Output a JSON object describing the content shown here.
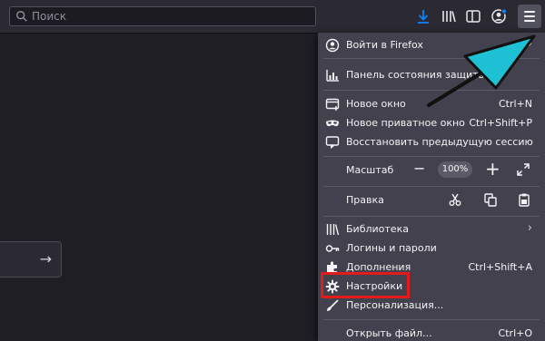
{
  "toolbar": {
    "search_placeholder": "Поиск",
    "icons": [
      "download-icon",
      "library-icon",
      "sidebar-icon",
      "account-icon",
      "hamburger-menu-icon"
    ]
  },
  "content": {
    "go_arrow": "→"
  },
  "menu": {
    "sign_in": "Войти в Firefox",
    "protections": "Панель состояния защиты",
    "new_window": {
      "label": "Новое окно",
      "shortcut": "Ctrl+N"
    },
    "private_window": {
      "label": "Новое приватное окно",
      "shortcut": "Ctrl+Shift+P"
    },
    "restore_session": "Восстановить предыдущую сессию",
    "zoom": {
      "label": "Масштаб",
      "value": "100%",
      "minus": "−",
      "plus": "+"
    },
    "edit": {
      "label": "Правка"
    },
    "library": "Библиотека",
    "logins": "Логины и пароли",
    "addons": {
      "label": "Дополнения",
      "shortcut": "Ctrl+Shift+A"
    },
    "settings": "Настройки",
    "customize": "Персонализация...",
    "open_file": {
      "label": "Открыть файл...",
      "shortcut": "Ctrl+O"
    },
    "submenu_arrow": "›"
  },
  "colors": {
    "toolbar": "#2b2a33",
    "panel": "#42414d",
    "accent_blue": "#0a84ff",
    "highlight_red": "#e41b1b",
    "annotation_arrow": "#1ec0d3"
  }
}
